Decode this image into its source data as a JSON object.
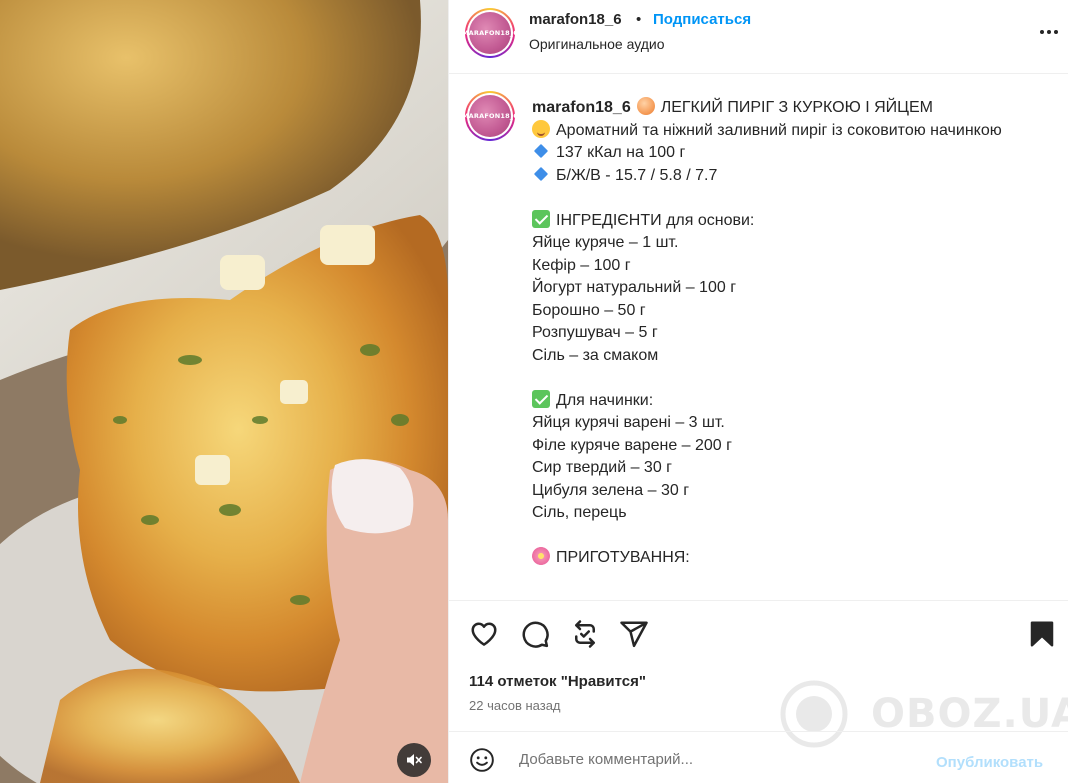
{
  "post": {
    "username": "marafon18_6",
    "avatar_text": "MARAFON18_6",
    "dot": "•",
    "follow_label": "Подписаться",
    "audio_label": "Оригинальное аудио",
    "caption_title": "ЛЕГКИЙ ПИРІГ З КУРКОЮ І ЯЙЦЕМ",
    "caption_lines": [
      {
        "emoji": "yum",
        "text": "Ароматний та ніжний заливний пиріг із соковитою начинкою"
      },
      {
        "emoji": "diamond",
        "text": "137 кКал на 100 г"
      },
      {
        "emoji": "diamond",
        "text": "Б/Ж/В - 15.7 / 5.8 / 7.7"
      },
      {
        "emoji": "",
        "text": ""
      },
      {
        "emoji": "check",
        "text": "ІНГРЕДІЄНТИ для основи:"
      },
      {
        "emoji": "",
        "text": "Яйце куряче – 1 шт."
      },
      {
        "emoji": "",
        "text": "Кефір – 100 г"
      },
      {
        "emoji": "",
        "text": "Йогурт натуральний – 100 г"
      },
      {
        "emoji": "",
        "text": "Борошно – 50 г"
      },
      {
        "emoji": "",
        "text": "Розпушувач – 5 г"
      },
      {
        "emoji": "",
        "text": "Сіль – за смаком"
      },
      {
        "emoji": "",
        "text": ""
      },
      {
        "emoji": "check",
        "text": "Для начинки:"
      },
      {
        "emoji": "",
        "text": "Яйця курячі варені – 3 шт."
      },
      {
        "emoji": "",
        "text": "Філе куряче варене – 200 г"
      },
      {
        "emoji": "",
        "text": "Сир твердий – 30 г"
      },
      {
        "emoji": "",
        "text": "Цибуля зелена – 30 г"
      },
      {
        "emoji": "",
        "text": "Сіль, перець"
      },
      {
        "emoji": "",
        "text": ""
      },
      {
        "emoji": "flower",
        "text": "ПРИГОТУВАННЯ:"
      }
    ],
    "likes_label": "114 отметок \"Нравится\"",
    "time_label": "22 часов назад",
    "comment_placeholder": "Добавьте комментарий...",
    "post_button_label": "Опубликовать",
    "watermark_text": "OBOZ.UA",
    "icons": {
      "more": "more-horizontal-icon",
      "like": "heart-icon",
      "comment": "comment-icon",
      "share": "repost-icon",
      "send": "send-icon",
      "save": "bookmark-icon",
      "emoji": "emoji-icon",
      "mute": "muted-speaker-icon"
    },
    "colors": {
      "accent": "#0095f6",
      "post_disabled": "#b2dffc",
      "muted_text": "#737373"
    }
  }
}
